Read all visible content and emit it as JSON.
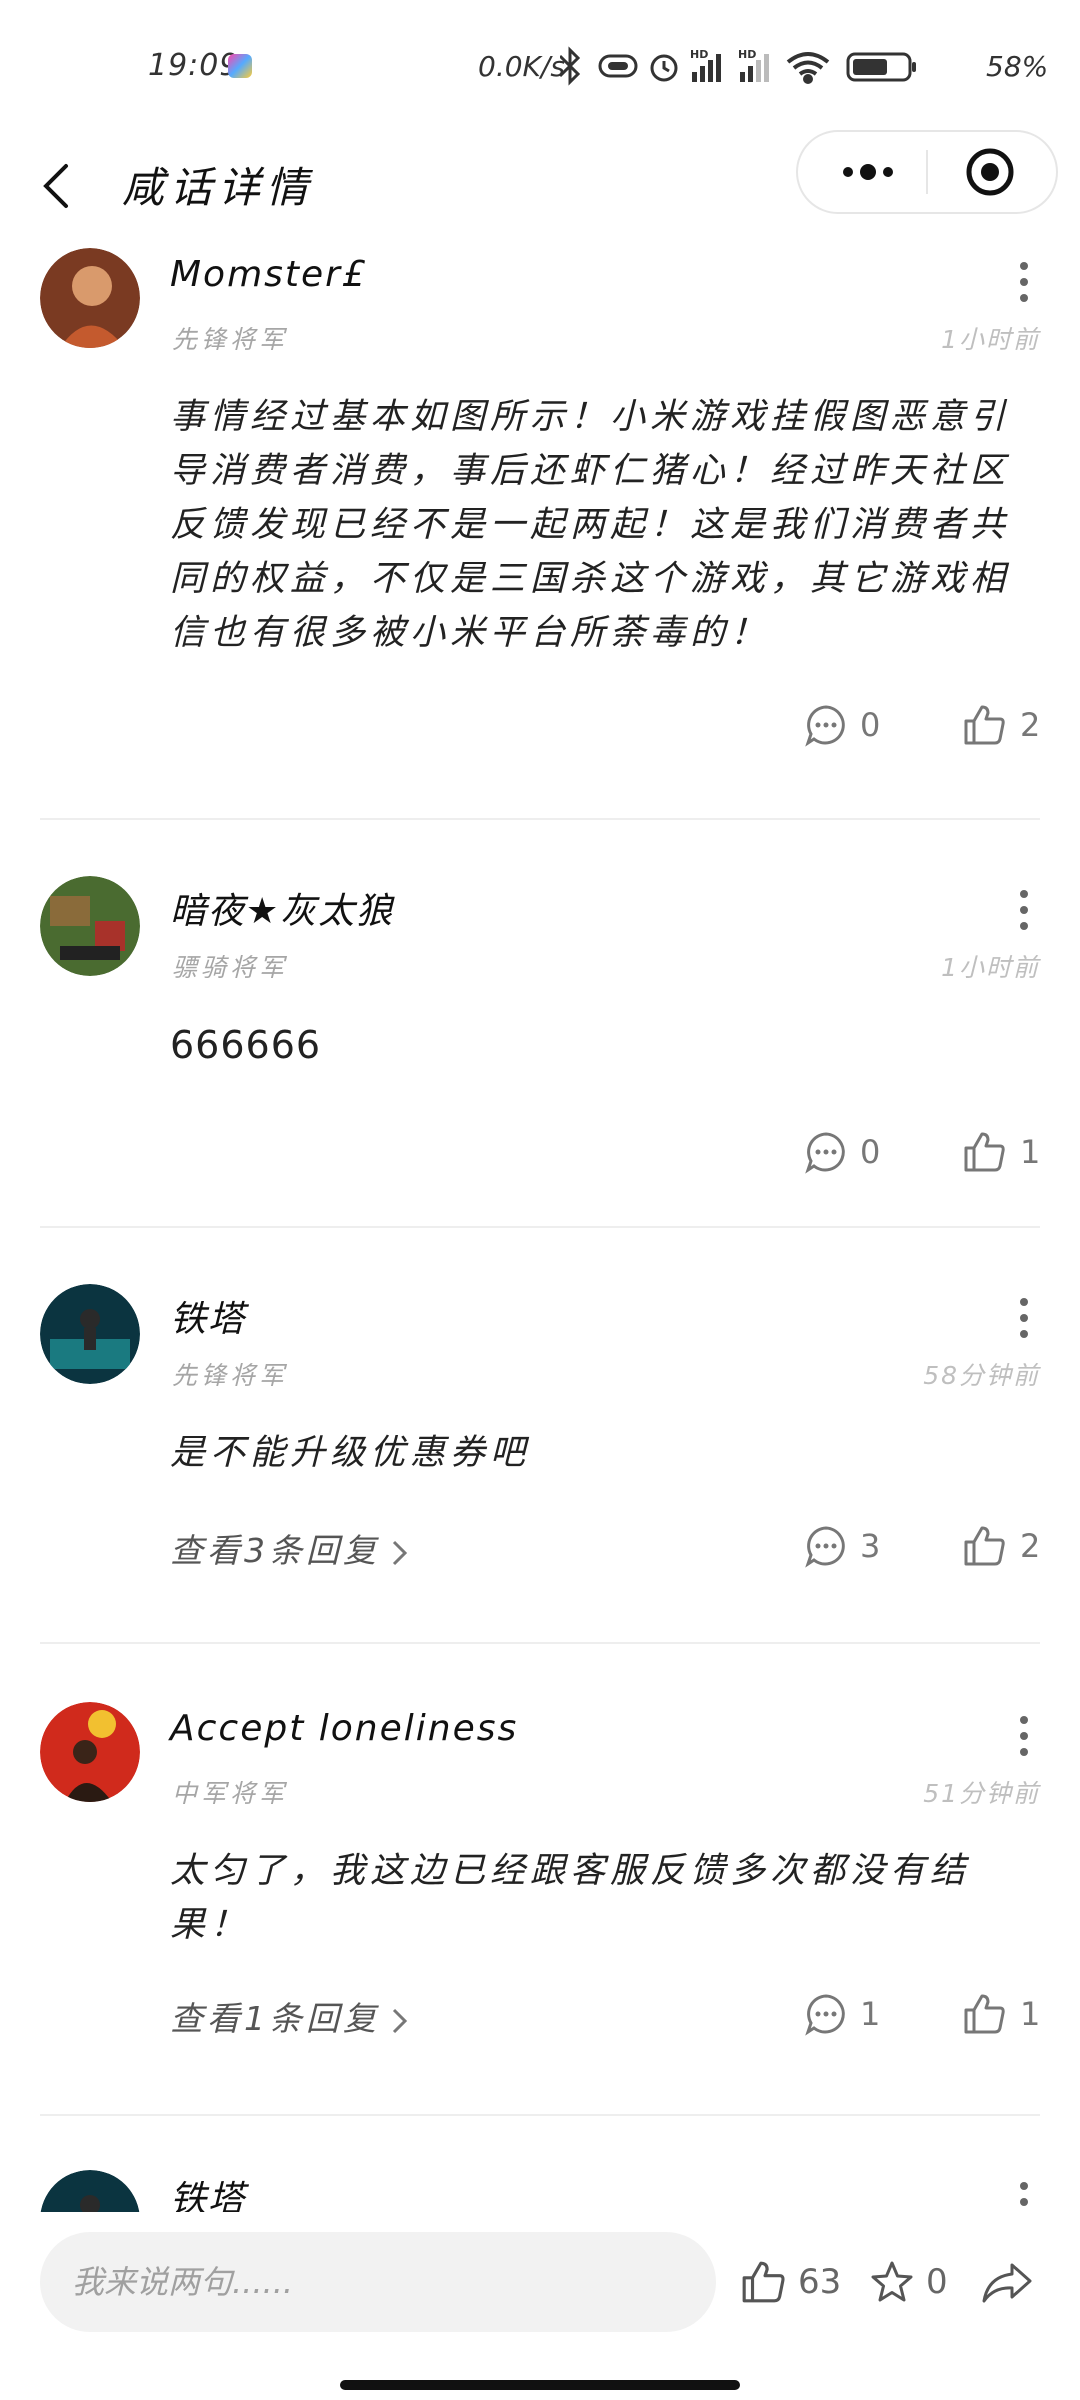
{
  "status_bar": {
    "time": "19:09",
    "network_speed": "0.0K/s",
    "battery_percent": "58%"
  },
  "header": {
    "title": "咸话详情"
  },
  "comments": [
    {
      "username": "Momster£",
      "rank": "先锋将军",
      "time": "1小时前",
      "content": "事情经过基本如图所示！小米游戏挂假图恶意引导消费者消费，事后还虾仁猪心！经过昨天社区反馈发现已经不是一起两起！这是我们消费者共同的权益，不仅是三国杀这个游戏，其它游戏相信也有很多被小米平台所荼毒的！",
      "comment_count": "0",
      "like_count": "2",
      "avatar_color": "#b05a3c"
    },
    {
      "username": "暗夜★灰太狼",
      "rank": "骠骑将军",
      "time": "1小时前",
      "content": "666666",
      "comment_count": "0",
      "like_count": "1",
      "avatar_color": "#3a6b2a"
    },
    {
      "username": "铁塔",
      "rank": "先锋将军",
      "time": "58分钟前",
      "content": "是不能升级优惠券吧",
      "replies_label": "查看3条回复",
      "comment_count": "3",
      "like_count": "2",
      "avatar_color": "#0f4a55"
    },
    {
      "username": "Accept loneliness",
      "rank": "中军将军",
      "time": "51分钟前",
      "content": "太匀了，我这边已经跟客服反馈多次都没有结果！",
      "replies_label": "查看1条回复",
      "comment_count": "1",
      "like_count": "1",
      "avatar_color": "#d23a2a"
    },
    {
      "username": "铁塔",
      "avatar_color": "#0f4a55"
    }
  ],
  "bottom_bar": {
    "input_placeholder": "我来说两句......",
    "like_count": "63",
    "favorite_count": "0"
  }
}
